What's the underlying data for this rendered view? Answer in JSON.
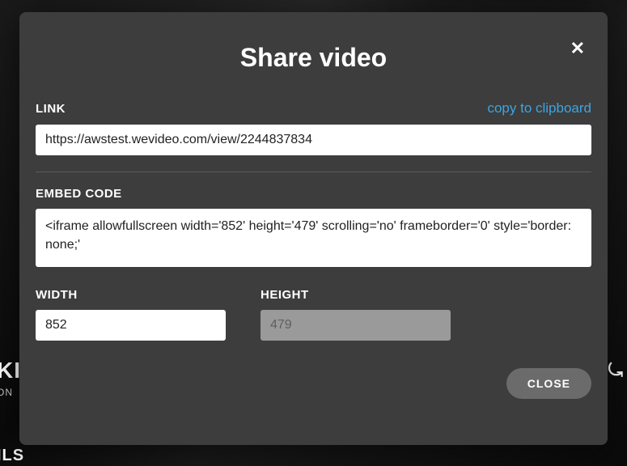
{
  "modal": {
    "title": "Share video",
    "close_icon_glyph": "✕"
  },
  "link": {
    "label": "LINK",
    "copy_action": "copy to clipboard",
    "value": "https://awstest.wevideo.com/view/2244837834"
  },
  "embed": {
    "label": "EMBED CODE",
    "value": "<iframe allowfullscreen width='852' height='479' scrolling='no' frameborder='0' style='border: none;'"
  },
  "width": {
    "label": "WIDTH",
    "value": "852"
  },
  "height": {
    "label": "HEIGHT",
    "value": "479"
  },
  "footer": {
    "close_label": "CLOSE"
  },
  "backdrop": {
    "frag1": "KI",
    "frag2": "ON",
    "frag3": "ILS",
    "frag4": "⤿"
  }
}
